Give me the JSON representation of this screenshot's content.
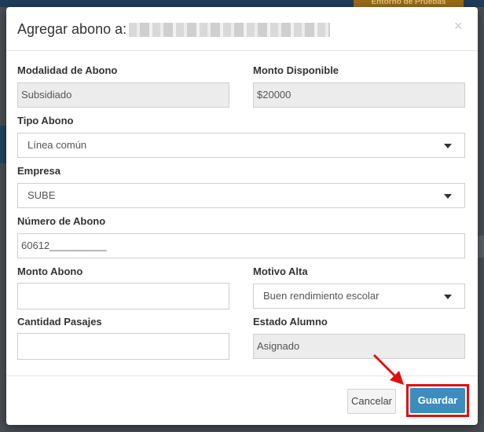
{
  "background": {
    "env_badge": "Entorno de Pruebas"
  },
  "modal": {
    "title": "Agregar abono a:",
    "close_symbol": "×",
    "fields": {
      "modalidad": {
        "label": "Modalidad de Abono",
        "value": "Subsidiado"
      },
      "monto_disponible": {
        "label": "Monto Disponible",
        "value": "$20000"
      },
      "tipo_abono": {
        "label": "Tipo Abono",
        "value": "Línea común"
      },
      "empresa": {
        "label": "Empresa",
        "value": "SUBE"
      },
      "numero_abono": {
        "label": "Número de Abono",
        "value": "60612__________"
      },
      "monto_abono": {
        "label": "Monto Abono",
        "value": ""
      },
      "motivo_alta": {
        "label": "Motivo Alta",
        "value": "Buen rendimiento escolar"
      },
      "cantidad_pasajes": {
        "label": "Cantidad Pasajes",
        "value": ""
      },
      "estado_alumno": {
        "label": "Estado Alumno",
        "value": "Asignado"
      }
    },
    "footer": {
      "cancel_label": "Cancelar",
      "save_label": "Guardar"
    }
  },
  "colors": {
    "primary": "#3c8dbc",
    "highlight": "#e01010"
  }
}
